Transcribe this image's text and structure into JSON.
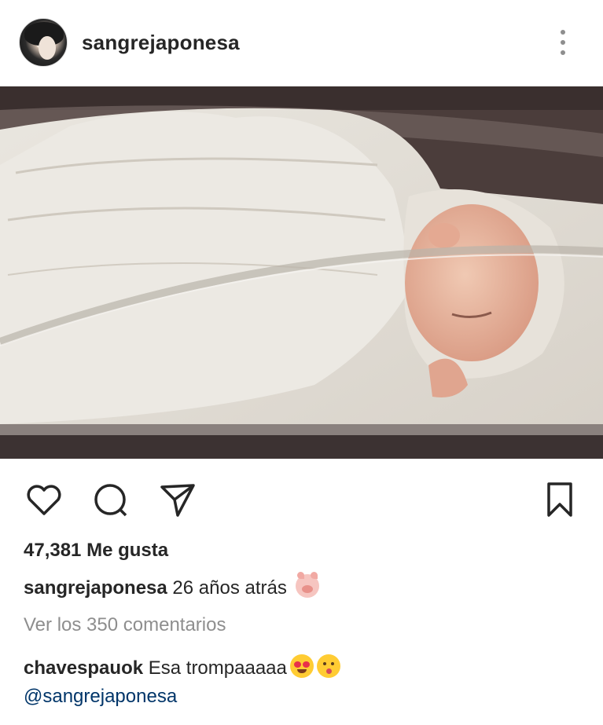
{
  "post": {
    "username": "sangrejaponesa",
    "likes_text": "47,381 Me gusta",
    "caption_user": "sangrejaponesa",
    "caption_text": "26 años atrás",
    "caption_emoji": "pig-face-emoji",
    "view_comments": "Ver los 350 comentarios"
  },
  "comment": {
    "user": "chavespauok",
    "text": "Esa trompaaaaa",
    "emojis": [
      "heart-eyes-emoji",
      "kissing-face-emoji"
    ],
    "mention": "@sangrejaponesa"
  },
  "icons": {
    "more": "more-vertical-icon",
    "like": "heart-outline-icon",
    "comment": "comment-bubble-icon",
    "share": "paper-plane-icon",
    "save": "bookmark-icon"
  }
}
